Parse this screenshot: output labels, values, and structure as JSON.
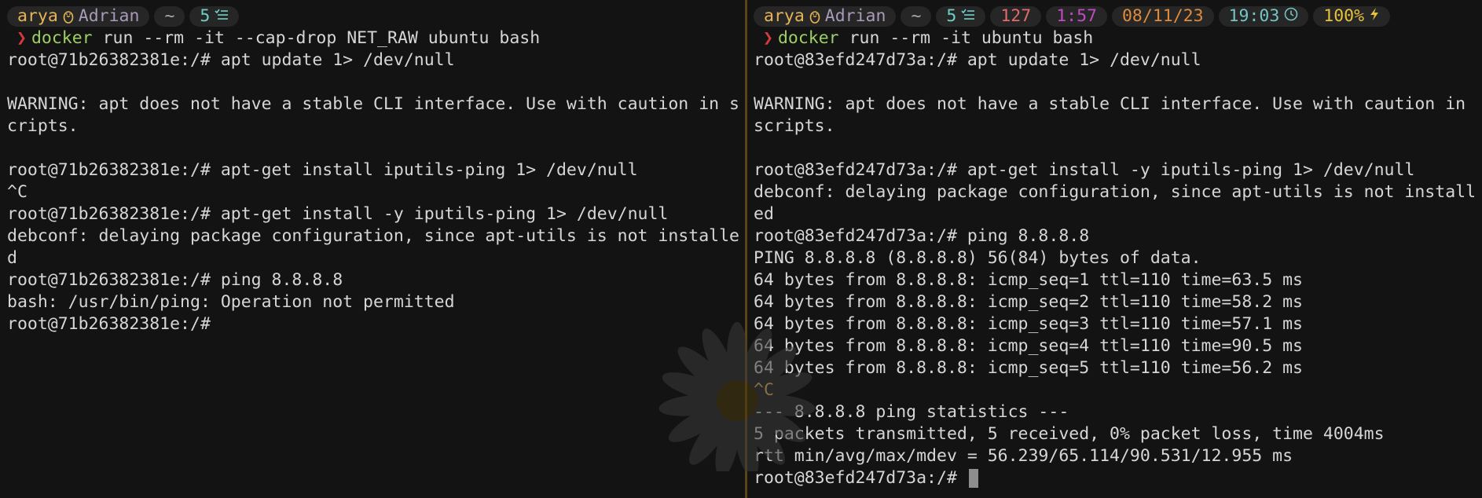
{
  "left_pane": {
    "prompt": {
      "user": "arya",
      "host": "Adrian",
      "dir": "~",
      "git_count": "5"
    },
    "command": {
      "chevron": "❯",
      "word": "docker",
      "args": " run --rm -it --cap-drop NET_RAW ubuntu bash"
    },
    "lines": [
      "root@71b26382381e:/# apt update 1> /dev/null",
      "",
      "WARNING: apt does not have a stable CLI interface. Use with caution in s",
      "cripts.",
      "",
      "root@71b26382381e:/# apt-get install iputils-ping 1> /dev/null",
      "^C",
      "root@71b26382381e:/# apt-get install -y iputils-ping 1> /dev/null",
      "debconf: delaying package configuration, since apt-utils is not installe",
      "d",
      "root@71b26382381e:/# ping 8.8.8.8",
      "bash: /usr/bin/ping: Operation not permitted",
      "root@71b26382381e:/#"
    ]
  },
  "right_pane": {
    "prompt": {
      "user": "arya",
      "host": "Adrian",
      "dir": "~",
      "git_count": "5",
      "exit_code": "127",
      "duration": "1:57",
      "date": "08/11/23",
      "time": "19:03",
      "battery": "100%"
    },
    "command": {
      "chevron": "❯",
      "word": "docker",
      "args": " run --rm -it ubuntu bash"
    },
    "lines": [
      "root@83efd247d73a:/# apt update 1> /dev/null",
      "",
      "WARNING: apt does not have a stable CLI interface. Use with caution in",
      "scripts.",
      "",
      "root@83efd247d73a:/# apt-get install -y iputils-ping 1> /dev/null",
      "debconf: delaying package configuration, since apt-utils is not install",
      "ed",
      "root@83efd247d73a:/# ping 8.8.8.8",
      "PING 8.8.8.8 (8.8.8.8) 56(84) bytes of data.",
      "64 bytes from 8.8.8.8: icmp_seq=1 ttl=110 time=63.5 ms",
      "64 bytes from 8.8.8.8: icmp_seq=2 ttl=110 time=58.2 ms",
      "64 bytes from 8.8.8.8: icmp_seq=3 ttl=110 time=57.1 ms",
      "64 bytes from 8.8.8.8: icmp_seq=4 ttl=110 time=90.5 ms",
      "64 bytes from 8.8.8.8: icmp_seq=5 ttl=110 time=56.2 ms",
      "^C",
      "--- 8.8.8.8 ping statistics ---",
      "5 packets transmitted, 5 received, 0% packet loss, time 4004ms",
      "rtt min/avg/max/mdev = 56.239/65.114/90.531/12.955 ms"
    ],
    "final_prompt": "root@83efd247d73a:/# "
  },
  "icons": {
    "os": "linux-tux-icon",
    "git": "checklist-icon",
    "clock": "clock-icon",
    "battery": "lightning-bolt-icon",
    "wallpaper": "daisy-flower"
  },
  "colors": {
    "background": "#131313",
    "segment_bg": "#262626",
    "user": "#e6b455",
    "host": "#a89ab8",
    "git": "#6fd0c8",
    "exit_code": "#e26a6a",
    "duration": "#c04ac4",
    "date": "#e08a3a",
    "time": "#74c4c4",
    "battery": "#e6c23a",
    "chevron": "#d23c3c",
    "command": "#9dcf62",
    "divider": "#5a4612"
  }
}
